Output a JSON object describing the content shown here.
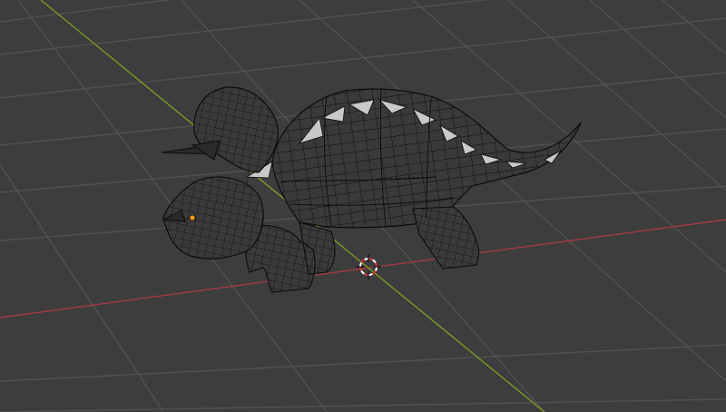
{
  "viewport": {
    "background_color": "#3d3d3d",
    "shading_mode": "wireframe"
  },
  "grid": {
    "line_color": "#535353",
    "x_axis_color": "#a33a45",
    "y_axis_color": "#7a9a26"
  },
  "object": {
    "kind": "triceratops-mesh",
    "wire_color": "#0c0c0c",
    "spike_fill": "#c8c8c8",
    "origin_color": "#ff9a1a"
  },
  "cursor": {
    "ring_color_a": "#ffffff",
    "ring_color_b": "#d23232",
    "crosshair_color": "#111111"
  }
}
